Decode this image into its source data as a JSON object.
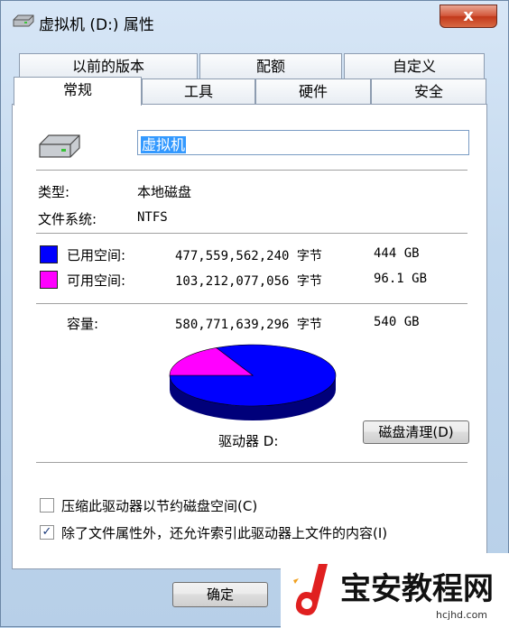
{
  "window": {
    "title": "虚拟机 (D:) 属性",
    "close_label": "x"
  },
  "tabs": {
    "row1": [
      "以前的版本",
      "配额",
      "自定义"
    ],
    "row2": [
      "常规",
      "工具",
      "硬件",
      "安全"
    ],
    "active": "常规"
  },
  "general": {
    "drive_name": "虚拟机",
    "type_label": "类型:",
    "type_value": "本地磁盘",
    "fs_label": "文件系统:",
    "fs_value": "NTFS",
    "used_label": "已用空间:",
    "used_bytes": "477,559,562,240 字节",
    "used_gb": "444 GB",
    "free_label": "可用空间:",
    "free_bytes": "103,212,077,056 字节",
    "free_gb": "96.1 GB",
    "capacity_label": "容量:",
    "capacity_bytes": "580,771,639,296 字节",
    "capacity_gb": "540 GB",
    "drive_label": "驱动器 D:",
    "cleanup_button": "磁盘清理(D)",
    "compress_label": "压缩此驱动器以节约磁盘空间(C)",
    "compress_checked": false,
    "index_label": "除了文件属性外，还允许索引此驱动器上文件的内容(I)",
    "index_checked": true
  },
  "colors": {
    "used": "#0000ff",
    "free": "#ff00ff"
  },
  "chart_data": {
    "type": "pie",
    "categories": [
      "已用空间",
      "可用空间"
    ],
    "values": [
      477559562240,
      103212077056
    ]
  },
  "footer": {
    "ok_button": "确定"
  },
  "watermark": {
    "text": "宝安教程网",
    "sub": "hcjhd.com"
  }
}
